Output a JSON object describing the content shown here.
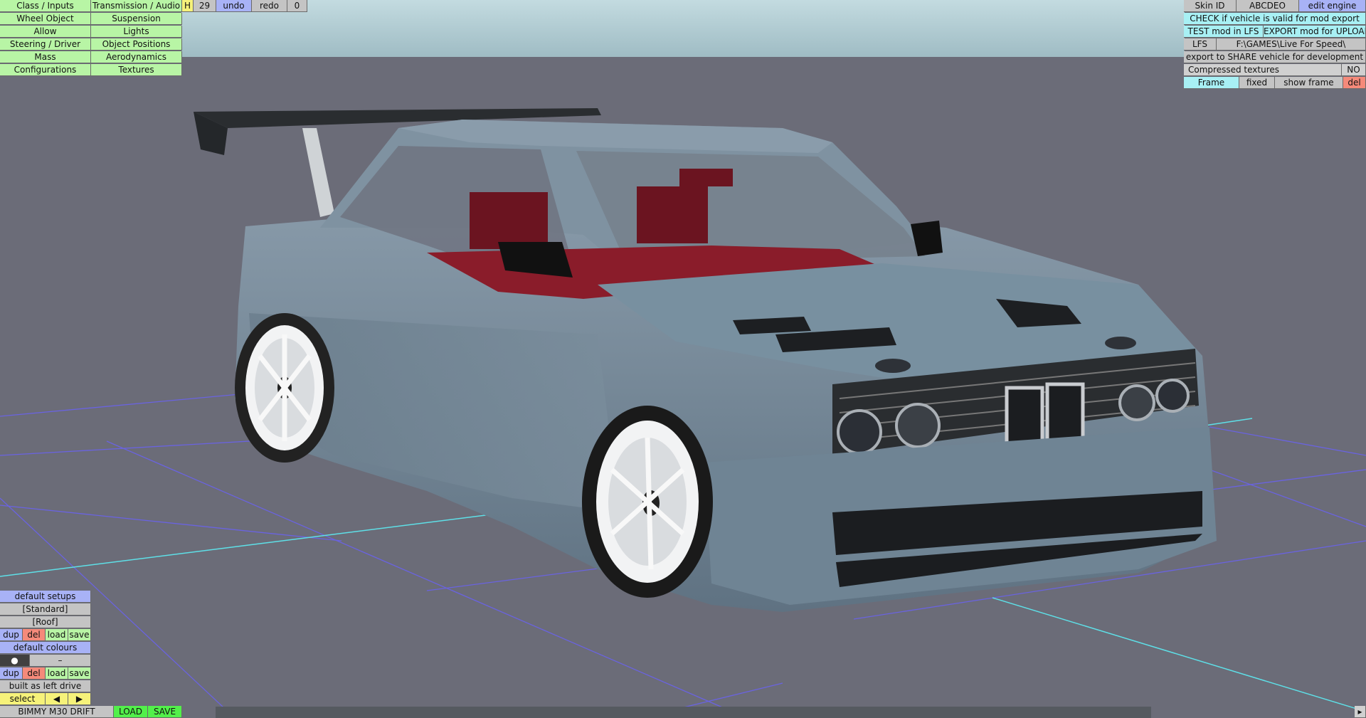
{
  "top_left_menu": [
    [
      "Class / Inputs",
      "Transmission / Audio"
    ],
    [
      "Wheel Object",
      "Suspension"
    ],
    [
      "Allow",
      "Lights"
    ],
    [
      "Steering / Driver",
      "Object Positions"
    ],
    [
      "Mass",
      "Aerodynamics"
    ],
    [
      "Configurations",
      "Textures"
    ]
  ],
  "history": {
    "h": "H",
    "count": "29",
    "undo": "undo",
    "redo": "redo",
    "redo_count": "0"
  },
  "top_right": {
    "skin_id_label": "Skin ID",
    "skin_id_value": "ABCDEO",
    "edit_engine": "edit engine",
    "check": "CHECK if vehicle is valid for mod export",
    "test": "TEST mod in LFS",
    "export": "EXPORT mod for UPLOAD",
    "lfs": "LFS",
    "path": "F:\\GAMES\\Live For Speed\\",
    "share": "export to SHARE vehicle for development",
    "compressed_label": "Compressed textures",
    "compressed_value": "NO",
    "frame": "Frame",
    "fixed": "fixed",
    "show_frame": "show frame",
    "del": "del"
  },
  "bottom_left": {
    "default_setups": "default setups",
    "standard": "[Standard]",
    "roof": "[Roof]",
    "dup": "dup",
    "del": "del",
    "load": "load",
    "save": "save",
    "default_colours": "default colours",
    "dot": "●",
    "dash": "–",
    "built": "built as left drive",
    "select": "select",
    "prev": "◀",
    "next": "▶",
    "vehicle_name": "BIMMY M30 DRIFT",
    "load_btn": "LOAD",
    "save_btn": "SAVE"
  },
  "scrollbar_arrow": "▸"
}
